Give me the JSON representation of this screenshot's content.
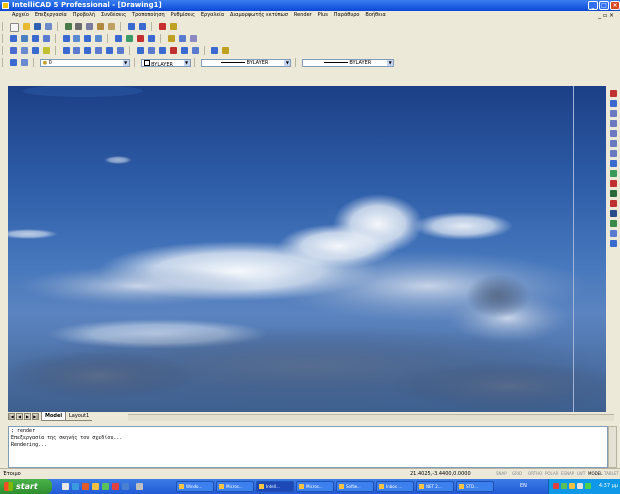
{
  "window": {
    "title": "IntelliCAD 5 Professional - [Drawing1]"
  },
  "menubar": {
    "items": [
      "Αρχείο",
      "Επεξεργασία",
      "Προβολή",
      "Συνδέσεις",
      "Τροποποίηση",
      "Ρυθμίσεις",
      "Εργαλεία",
      "Διαμορφωτής εκτύπωσ",
      "Render",
      "Plus",
      "Παράθυρο",
      "Βοήθεια"
    ]
  },
  "layer_bar": {
    "layer_value": "0",
    "color_value": "BYLAYER",
    "linetype_value": "BYLAYER",
    "lineweight_value": "BYLAYER"
  },
  "tabs": {
    "model": "Model",
    "layout1": "Layout1"
  },
  "command_window": {
    "lines": [
      "; render",
      "Επεξεργασία της σκηνής του σχεδίου...",
      "Rendering..."
    ]
  },
  "status_bar": {
    "left": "Έτοιμο",
    "coords": "21.4025,-3.4400,0.0000",
    "toggles": [
      "SNAP",
      "GRID",
      "ORTHO",
      "POLAR",
      "ESNAP",
      "LWT",
      "MODEL",
      "TABLET"
    ]
  },
  "taskbar": {
    "start_label": "start",
    "tasks": [
      "Windo...",
      "Micros...",
      "Intell...",
      "Micros...",
      "Softw...",
      "Inbox ...",
      "NET 2...",
      "STD..."
    ],
    "tray_lang": "EN",
    "clock": "4:37 μμ"
  },
  "colors": {
    "sky_top": "#1c3f86",
    "sky_mid": "#4778bd",
    "sky_low": "#3e5f8e",
    "titlebar": "#0a49d6",
    "taskbar": "#225ad6"
  }
}
